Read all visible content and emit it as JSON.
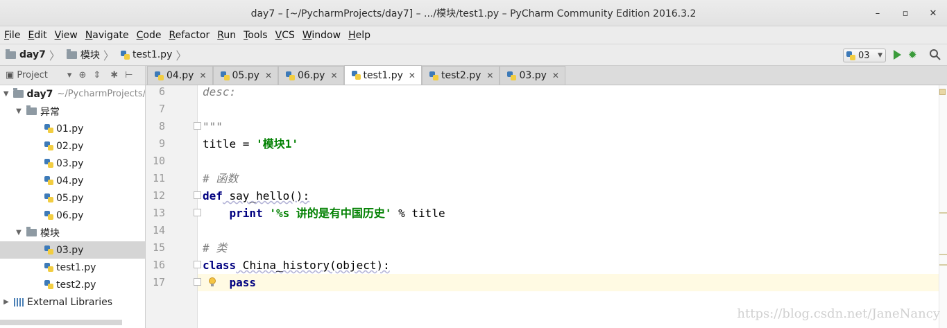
{
  "window": {
    "title": "day7 – [~/PycharmProjects/day7] – .../模块/test1.py – PyCharm Community Edition 2016.3.2",
    "controls": [
      "–",
      "▫",
      "✕"
    ]
  },
  "menu": [
    "File",
    "Edit",
    "View",
    "Navigate",
    "Code",
    "Refactor",
    "Run",
    "Tools",
    "VCS",
    "Window",
    "Help"
  ],
  "breadcrumb": [
    {
      "label": "day7",
      "icon": "folder-icon"
    },
    {
      "label": "模块",
      "icon": "folder-icon"
    },
    {
      "label": "test1.py",
      "icon": "python-file-icon"
    }
  ],
  "run_config": {
    "label": "03"
  },
  "project_panel": {
    "title": "Project",
    "tree": [
      {
        "label": "day7",
        "path": "~/PycharmProjects/",
        "type": "folder",
        "expanded": true
      },
      {
        "label": "异常",
        "type": "folder",
        "expanded": true
      },
      {
        "label": "01.py",
        "type": "file"
      },
      {
        "label": "02.py",
        "type": "file"
      },
      {
        "label": "03.py",
        "type": "file"
      },
      {
        "label": "04.py",
        "type": "file"
      },
      {
        "label": "05.py",
        "type": "file"
      },
      {
        "label": "06.py",
        "type": "file"
      },
      {
        "label": "模块",
        "type": "folder",
        "expanded": true
      },
      {
        "label": "03.py",
        "type": "file",
        "selected": true
      },
      {
        "label": "test1.py",
        "type": "file"
      },
      {
        "label": "test2.py",
        "type": "file"
      },
      {
        "label": "External Libraries",
        "type": "library",
        "expanded": false
      }
    ]
  },
  "tabs": [
    {
      "label": "04.py",
      "active": false
    },
    {
      "label": "05.py",
      "active": false
    },
    {
      "label": "06.py",
      "active": false
    },
    {
      "label": "test1.py",
      "active": true
    },
    {
      "label": "test2.py",
      "active": false
    },
    {
      "label": "03.py",
      "active": false
    }
  ],
  "editor": {
    "line_numbers": [
      "6",
      "7",
      "8",
      "9",
      "10",
      "11",
      "12",
      "13",
      "14",
      "15",
      "16",
      "17"
    ],
    "lines": {
      "l6": "desc:",
      "l8": "\"\"\"",
      "l9_a": "title = ",
      "l9_str": "'模块1'",
      "l11": "# 函数",
      "l12_kw": "def",
      "l12_rest": " say_hello():",
      "l13_indent": "    ",
      "l13_kw": "print",
      "l13_sp": " ",
      "l13_str": "'%s 讲的是有中国历史'",
      "l13_rest": " % title",
      "l15": "# 类",
      "l16_kw": "class",
      "l16_rest": " China_history(object):",
      "l17_indent": "    ",
      "l17_kw": "pass"
    }
  },
  "watermark": "https://blog.csdn.net/JaneNancy",
  "colors": {
    "keyword": "#000080",
    "string": "#008000",
    "comment": "#808080",
    "caret_line": "#fffae3"
  }
}
